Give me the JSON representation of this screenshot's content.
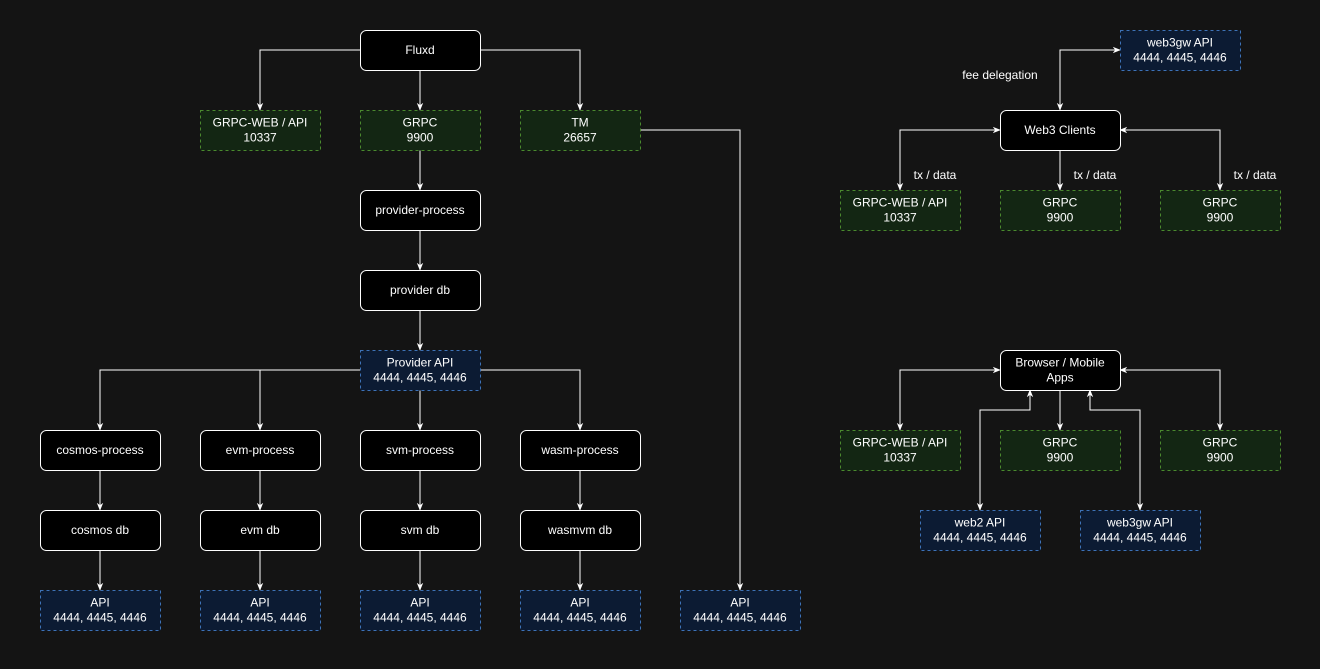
{
  "colors": {
    "background": "#141414",
    "process_fill": "#000000",
    "process_stroke": "#ffffff",
    "port_fill": "#132613",
    "port_stroke": "#4a8a2e",
    "api_fill": "#0c1b33",
    "api_stroke": "#3d72b8"
  },
  "nodes": {
    "fluxd": {
      "label": [
        "Fluxd"
      ],
      "kind": "process"
    },
    "grpcweb_main": {
      "label": [
        "GRPC-WEB / API",
        "10337"
      ],
      "kind": "port"
    },
    "grpc_main": {
      "label": [
        "GRPC",
        "9900"
      ],
      "kind": "port"
    },
    "tm": {
      "label": [
        "TM",
        "26657"
      ],
      "kind": "port"
    },
    "provider_process": {
      "label": [
        "provider-process"
      ],
      "kind": "process"
    },
    "provider_db": {
      "label": [
        "provider db"
      ],
      "kind": "process"
    },
    "provider_api": {
      "label": [
        "Provider API",
        "4444, 4445, 4446"
      ],
      "kind": "api"
    },
    "cosmos_process": {
      "label": [
        "cosmos-process"
      ],
      "kind": "process"
    },
    "evm_process": {
      "label": [
        "evm-process"
      ],
      "kind": "process"
    },
    "svm_process": {
      "label": [
        "svm-process"
      ],
      "kind": "process"
    },
    "wasm_process": {
      "label": [
        "wasm-process"
      ],
      "kind": "process"
    },
    "cosmos_db": {
      "label": [
        "cosmos db"
      ],
      "kind": "process"
    },
    "evm_db": {
      "label": [
        "evm db"
      ],
      "kind": "process"
    },
    "svm_db": {
      "label": [
        "svm db"
      ],
      "kind": "process"
    },
    "wasmvm_db": {
      "label": [
        "wasmvm db"
      ],
      "kind": "process"
    },
    "api_cosmos": {
      "label": [
        "API",
        "4444, 4445, 4446"
      ],
      "kind": "api"
    },
    "api_evm": {
      "label": [
        "API",
        "4444, 4445, 4446"
      ],
      "kind": "api"
    },
    "api_svm": {
      "label": [
        "API",
        "4444, 4445, 4446"
      ],
      "kind": "api"
    },
    "api_wasm": {
      "label": [
        "API",
        "4444, 4445, 4446"
      ],
      "kind": "api"
    },
    "api_tm": {
      "label": [
        "API",
        "4444, 4445, 4446"
      ],
      "kind": "api"
    },
    "web3gw_top": {
      "label": [
        "web3gw API",
        "4444, 4445, 4446"
      ],
      "kind": "api"
    },
    "web3_clients": {
      "label": [
        "Web3 Clients"
      ],
      "kind": "process"
    },
    "w3c_grpcweb": {
      "label": [
        "GRPC-WEB / API",
        "10337"
      ],
      "kind": "port"
    },
    "w3c_grpc_a": {
      "label": [
        "GRPC",
        "9900"
      ],
      "kind": "port"
    },
    "w3c_grpc_b": {
      "label": [
        "GRPC",
        "9900"
      ],
      "kind": "port"
    },
    "browser_apps": {
      "label": [
        "Browser / Mobile",
        "Apps"
      ],
      "kind": "process"
    },
    "br_grpcweb": {
      "label": [
        "GRPC-WEB / API",
        "10337"
      ],
      "kind": "port"
    },
    "br_grpc_a": {
      "label": [
        "GRPC",
        "9900"
      ],
      "kind": "port"
    },
    "br_grpc_b": {
      "label": [
        "GRPC",
        "9900"
      ],
      "kind": "port"
    },
    "web2_api": {
      "label": [
        "web2 API",
        "4444, 4445, 4446"
      ],
      "kind": "api"
    },
    "web3gw_bottom": {
      "label": [
        "web3gw API",
        "4444, 4445, 4446"
      ],
      "kind": "api"
    }
  },
  "edge_labels": {
    "fee_delegation": "fee delegation",
    "tx_data_1": "tx / data",
    "tx_data_2": "tx / data",
    "tx_data_3": "tx / data"
  }
}
